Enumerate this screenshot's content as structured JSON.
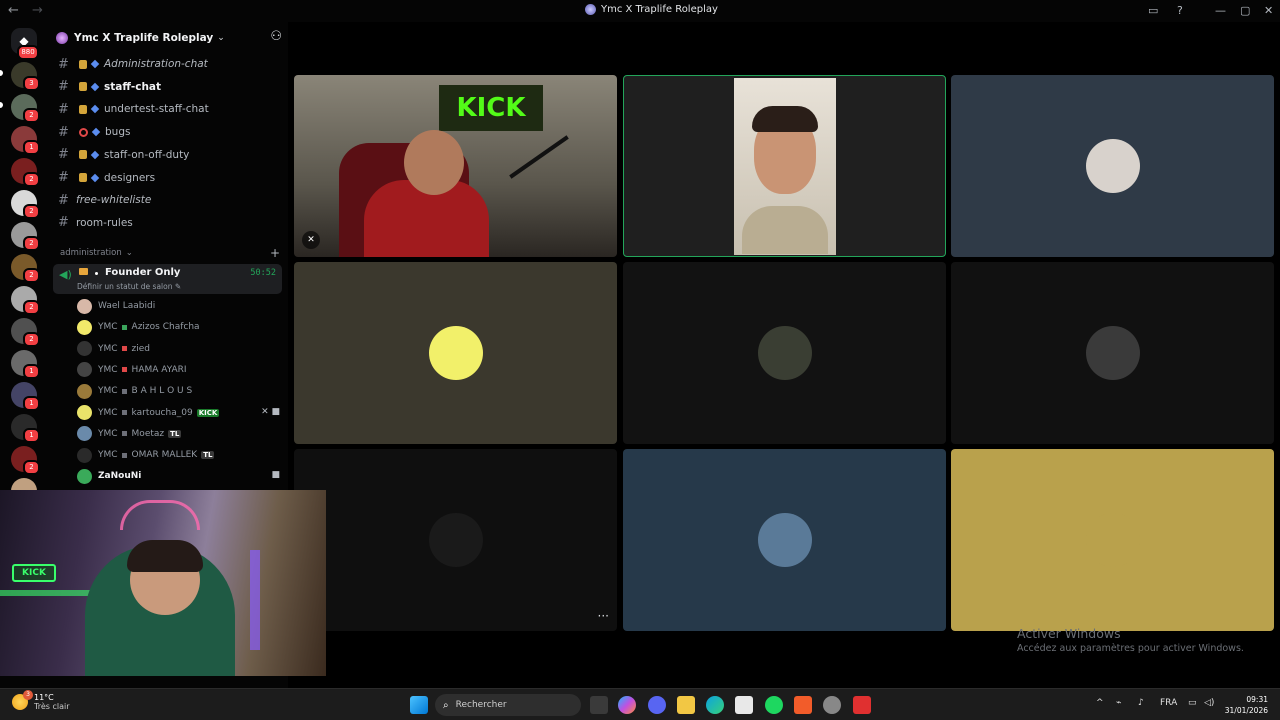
{
  "titlebar": {
    "title": "Ymc X Traplife Roleplay",
    "back_icon": "←",
    "forward_icon": "→"
  },
  "rail": {
    "home_badge": "880",
    "servers": [
      {
        "badge": "3",
        "color": "#3a3a2a"
      },
      {
        "badge": "2",
        "color": "#5b6b5b"
      },
      {
        "badge": "1",
        "color": "#8a3a3a"
      },
      {
        "badge": "2",
        "color": "#7a1f1f"
      },
      {
        "badge": "2",
        "color": "#d9d9d9"
      },
      {
        "badge": "2",
        "color": "#9a9a9a"
      },
      {
        "badge": "2",
        "color": "#7a5a2a"
      },
      {
        "badge": "2",
        "color": "#aaaaaa"
      },
      {
        "badge": "2",
        "color": "#505050"
      },
      {
        "badge": "1",
        "color": "#6a6a6a"
      },
      {
        "badge": "1",
        "color": "#444466"
      },
      {
        "badge": "1",
        "color": "#2a2a2a"
      },
      {
        "badge": "2",
        "color": "#7a1f1f"
      },
      {
        "badge": "",
        "color": "#c0a080"
      }
    ]
  },
  "server": {
    "name": "Ymc X Traplife Roleplay"
  },
  "channels": [
    {
      "name": "Administration-chat",
      "style": "ital",
      "icon": "lock"
    },
    {
      "name": "staff-chat",
      "style": "bold",
      "icon": "lock"
    },
    {
      "name": "undertest-staff-chat",
      "style": "normal",
      "icon": "lock"
    },
    {
      "name": "bugs",
      "style": "normal",
      "icon": "noentry"
    },
    {
      "name": "staff-on-off-duty",
      "style": "normal",
      "icon": "lock"
    },
    {
      "name": "designers",
      "style": "normal",
      "icon": "lock"
    },
    {
      "name": "free-whiteliste",
      "style": "ital",
      "icon": "none"
    },
    {
      "name": "room-rules",
      "style": "normal",
      "icon": "none"
    }
  ],
  "category": {
    "label": "administration",
    "plus": "+"
  },
  "voice_channel": {
    "name": "Founder Only",
    "time": "50:52",
    "status": "Définir un statut de salon ✎"
  },
  "members": [
    {
      "prefix": "",
      "name": "Wael Laabidi",
      "tag": "",
      "tag_color": "",
      "online": false,
      "icons": "",
      "sep_color": ""
    },
    {
      "prefix": "YMC",
      "name": "Azizos Chafcha",
      "tag": "",
      "tag_color": "",
      "online": false,
      "icons": "",
      "sep_color": "#3ba55c"
    },
    {
      "prefix": "YMC",
      "name": "zied",
      "tag": "",
      "tag_color": "",
      "online": false,
      "icons": "",
      "sep_color": "#e04848"
    },
    {
      "prefix": "YMC",
      "name": "HAMA AYARI",
      "tag": "",
      "tag_color": "",
      "online": false,
      "icons": "",
      "sep_color": "#e04848"
    },
    {
      "prefix": "YMC",
      "name": "B A H L O U S",
      "tag": "",
      "tag_color": "",
      "online": false,
      "icons": "",
      "sep_color": "#6d6f78"
    },
    {
      "prefix": "YMC",
      "name": "kartoucha_09",
      "tag": "KICK",
      "tag_color": "#1a7a2a",
      "online": false,
      "icons": "✕ ■",
      "sep_color": "#6d6f78"
    },
    {
      "prefix": "YMC",
      "name": "Moetaz",
      "tag": "TL",
      "tag_color": "#3a3a3a",
      "online": false,
      "icons": "",
      "sep_color": "#6d6f78"
    },
    {
      "prefix": "YMC",
      "name": "OMAR MALLEK",
      "tag": "TL",
      "tag_color": "#3a3a3a",
      "online": false,
      "icons": "",
      "sep_color": "#6d6f78"
    },
    {
      "prefix": "",
      "name": "ZaNouNi",
      "tag": "",
      "tag_color": "",
      "online": true,
      "icons": "■",
      "sep_color": ""
    }
  ],
  "stage": {
    "tiles": [
      {
        "type": "video",
        "label": "KICK",
        "bg": "#6e6a5e",
        "avatar": ""
      },
      {
        "type": "video-active",
        "label": "",
        "bg": "#1f1f1f",
        "avatar": ""
      },
      {
        "type": "avatar",
        "label": "",
        "bg": "#2f3a47",
        "avatar": "#d8d2cc"
      },
      {
        "type": "avatar",
        "label": "",
        "bg": "#3b382d",
        "avatar": "#f2f06a"
      },
      {
        "type": "avatar",
        "label": "",
        "bg": "#121212",
        "avatar": "#3a3e33"
      },
      {
        "type": "avatar",
        "label": "",
        "bg": "#111111",
        "avatar": "#3a3a3a"
      },
      {
        "type": "avatar",
        "label": "",
        "bg": "#0f0f0f",
        "avatar": "#1a1a1a"
      },
      {
        "type": "avatar",
        "label": "",
        "bg": "#26394a",
        "avatar": "#5a7a98"
      },
      {
        "type": "avatar",
        "label": "",
        "bg": "#b9a14c",
        "avatar": "#b9a14c"
      }
    ],
    "more_icon": "···"
  },
  "watermark": {
    "line1": "Activer Windows",
    "line2": "Accédez aux paramètres pour activer Windows."
  },
  "webcam": {
    "sign_text": "KICK"
  },
  "taskbar": {
    "weather_temp": "11°C",
    "weather_text": "Très clair",
    "weather_badge": "3",
    "search_placeholder": "Rechercher",
    "lang": "FRA",
    "time": "09:31",
    "date": "31/01/2026"
  }
}
